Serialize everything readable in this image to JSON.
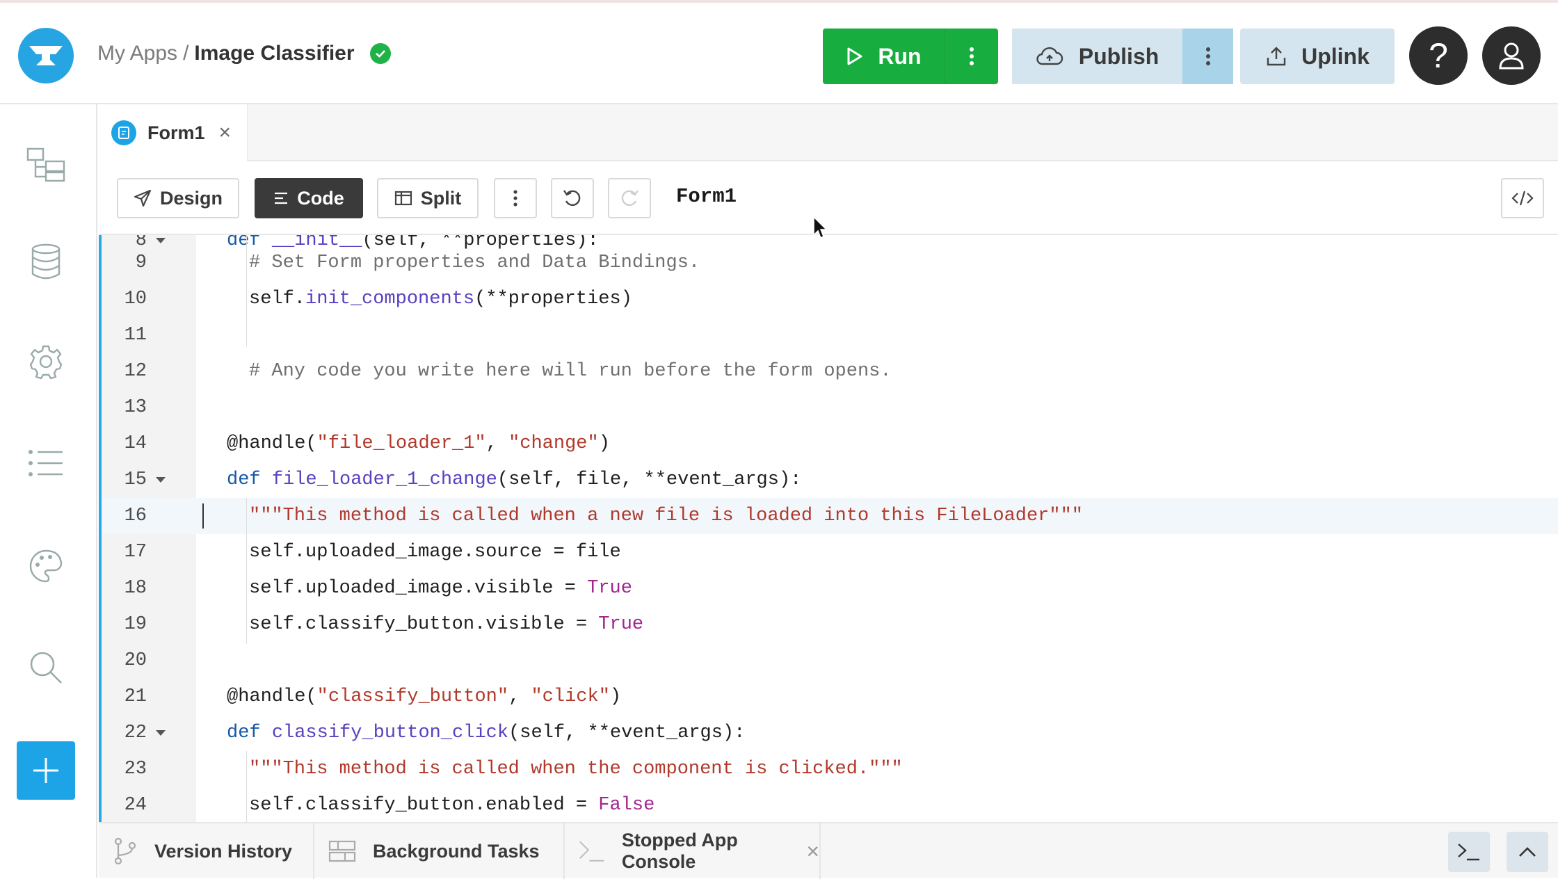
{
  "header": {
    "breadcrumb_root": "My Apps",
    "breadcrumb_sep": "/",
    "app_name": "Image Classifier",
    "run_label": "Run",
    "publish_label": "Publish",
    "uplink_label": "Uplink",
    "help_label": "?"
  },
  "tabs": [
    {
      "label": "Form1",
      "close": "×"
    }
  ],
  "toolbar": {
    "design_label": "Design",
    "code_label": "Code",
    "split_label": "Split",
    "form_title": "Form1"
  },
  "editor": {
    "current_line": 16,
    "lines": [
      {
        "num": "8",
        "fold": true
      },
      {
        "num": "9"
      },
      {
        "num": "10"
      },
      {
        "num": "11"
      },
      {
        "num": "12"
      },
      {
        "num": "13"
      },
      {
        "num": "14"
      },
      {
        "num": "15",
        "fold": true
      },
      {
        "num": "16"
      },
      {
        "num": "17"
      },
      {
        "num": "18"
      },
      {
        "num": "19"
      },
      {
        "num": "20"
      },
      {
        "num": "21"
      },
      {
        "num": "22",
        "fold": true
      },
      {
        "num": "23"
      },
      {
        "num": "24"
      }
    ],
    "code": {
      "l8_kw": "def",
      "l8_fn": "__init__",
      "l8_rest": "(self, **properties):",
      "l9": "# Set Form properties and Data Bindings.",
      "l10_a": "self.",
      "l10_fn": "init_components",
      "l10_b": "(**properties)",
      "l12": "# Any code you write here will run before the form opens.",
      "l14_a": "@handle(",
      "l14_s1": "\"file_loader_1\"",
      "l14_b": ", ",
      "l14_s2": "\"change\"",
      "l14_c": ")",
      "l15_kw": "def",
      "l15_fn": "file_loader_1_change",
      "l15_rest": "(self, file, **event_args):",
      "l16": "\"\"\"This method is called when a new file is loaded into this FileLoader\"\"\"",
      "l17": "self.uploaded_image.source = file",
      "l18_a": "self.uploaded_image.visible = ",
      "l18_b": "True",
      "l19_a": "self.classify_button.visible = ",
      "l19_b": "True",
      "l21_a": "@handle(",
      "l21_s1": "\"classify_button\"",
      "l21_b": ", ",
      "l21_s2": "\"click\"",
      "l21_c": ")",
      "l22_kw": "def",
      "l22_fn": "classify_button_click",
      "l22_rest": "(self, **event_args):",
      "l23": "\"\"\"This method is called when the component is clicked.\"\"\"",
      "l24_a": "self.classify_button.enabled = ",
      "l24_b": "False"
    }
  },
  "bottom": {
    "version_history": "Version History",
    "background_tasks": "Background Tasks",
    "app_console": "Stopped App Console",
    "close": "×"
  },
  "colors": {
    "run_green": "#18ad3f",
    "accent_blue": "#1ca4e6",
    "publish_bg": "#d5e5ef",
    "keyword": "#1458a6",
    "string": "#b0392b",
    "boolean": "#a2268e"
  },
  "icons": [
    "anvil-logo-icon",
    "check-circle-icon",
    "play-icon",
    "more-vertical-icon",
    "cloud-upload-icon",
    "upload-icon",
    "help-icon",
    "user-icon",
    "app-tree-icon",
    "database-icon",
    "gear-icon",
    "list-icon",
    "palette-icon",
    "search-icon",
    "plus-icon",
    "form-icon",
    "close-icon",
    "send-icon",
    "code-lines-icon",
    "split-icon",
    "undo-icon",
    "redo-icon",
    "code-toggle-icon",
    "chevron-down-icon",
    "branch-icon",
    "tasks-icon",
    "terminal-icon",
    "chevron-up-icon"
  ]
}
